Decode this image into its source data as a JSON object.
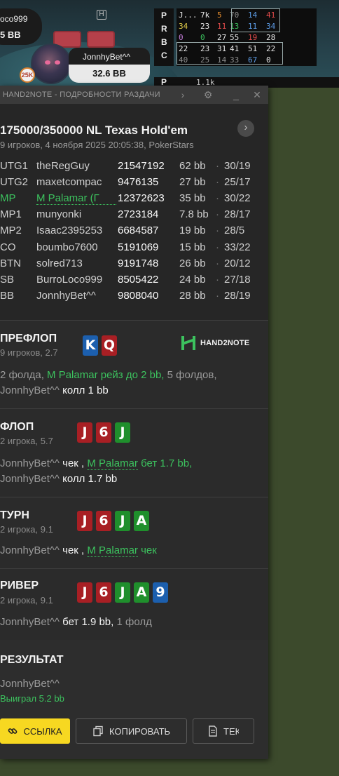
{
  "table": {
    "left_seat_name": "oco999",
    "left_seat_stack": "5 BB",
    "dealer_marker": "H",
    "hero_name": "JonnhyBet^^",
    "hero_stack": "32.6 BB",
    "badge": "25K"
  },
  "hud": {
    "letters": [
      "P",
      "R",
      "B",
      "C"
    ],
    "rows": [
      [
        {
          "v": "J...",
          "c": "#e6e6e6"
        },
        {
          "v": "7k",
          "c": "#e6e6e6"
        },
        {
          "v": "5",
          "c": "#e08a2e"
        },
        {
          "v": "70",
          "c": "#8c8c8c"
        },
        {
          "v": "14",
          "c": "#5c9ce6"
        },
        {
          "v": "41",
          "c": "#e04a4a"
        }
      ],
      [
        {
          "v": "34",
          "c": "#e6d04a"
        },
        {
          "v": "23",
          "c": "#e6e6e6"
        },
        {
          "v": "11",
          "c": "#e04a4a"
        },
        {
          "v": "13",
          "c": "#3cc25e"
        },
        {
          "v": "11",
          "c": "#5c9ce6"
        },
        {
          "v": "34",
          "c": "#5c9ce6"
        }
      ],
      [
        {
          "v": "0",
          "c": "#c07ad6"
        },
        {
          "v": "0",
          "c": "#3cc25e"
        },
        {
          "v": "27",
          "c": "#e6e6e6"
        },
        {
          "v": "55",
          "c": "#e6e6e6"
        },
        {
          "v": "19",
          "c": "#e04a4a"
        },
        {
          "v": "28",
          "c": "#e6e6e6"
        }
      ],
      [
        {
          "v": "22",
          "c": "#e6e6e6"
        },
        {
          "v": "23",
          "c": "#e6e6e6"
        },
        {
          "v": "31",
          "c": "#e6e6e6"
        },
        {
          "v": "41",
          "c": "#e6e6e6"
        },
        {
          "v": "51",
          "c": "#e6e6e6"
        },
        {
          "v": "22",
          "c": "#e6e6e6"
        }
      ],
      [
        {
          "v": "40",
          "c": "#8c8c8c"
        },
        {
          "v": "25",
          "c": "#8c8c8c"
        },
        {
          "v": "14",
          "c": "#8c8c8c"
        },
        {
          "v": "33",
          "c": "#8c8c8c"
        },
        {
          "v": "67",
          "c": "#5c9ce6"
        },
        {
          "v": "0",
          "c": "#e6e6e6"
        }
      ]
    ],
    "bottom_letter": "P",
    "bottom_text": "1.1k"
  },
  "window": {
    "title": "HAND2NOTE - ПОДРОБНОСТИ РАЗДАЧИ",
    "game_title": "175000/350000 NL Texas Hold'em",
    "game_sub": "9 игроков, 4 ноября 2025 20:05:38, PokerStars",
    "next_icon": "›",
    "players": [
      {
        "pos": "UTG1",
        "name": "theRegGuy",
        "id": "21547192",
        "bb": "62 bb",
        "stat": "30/19",
        "hl": false
      },
      {
        "pos": "UTG2",
        "name": "maxetcompac",
        "id": "9476135",
        "bb": "27 bb",
        "stat": "25/17",
        "hl": false
      },
      {
        "pos": "MP",
        "name": "M Palamar (Г",
        "id": "12372623",
        "bb": "35 bb",
        "stat": "30/22",
        "hl": true
      },
      {
        "pos": "MP1",
        "name": "munyonki",
        "id": "2723184",
        "bb": "7.8 bb",
        "stat": "28/17",
        "hl": false
      },
      {
        "pos": "MP2",
        "name": "Isaac2395253",
        "id": "6684587",
        "bb": "19 bb",
        "stat": "28/5",
        "hl": false
      },
      {
        "pos": "CO",
        "name": "boumbo7600",
        "id": "5191069",
        "bb": "15 bb",
        "stat": "33/22",
        "hl": false
      },
      {
        "pos": "BTN",
        "name": "solred713",
        "id": "9191748",
        "bb": "26 bb",
        "stat": "20/12",
        "hl": false
      },
      {
        "pos": "SB",
        "name": "BurroLoco999",
        "id": "8505422",
        "bb": "24 bb",
        "stat": "27/18",
        "hl": false
      },
      {
        "pos": "BB",
        "name": "JonnhyBet^^",
        "id": "9808040",
        "bb": "28 bb",
        "stat": "28/19",
        "hl": false
      }
    ],
    "dot": "·"
  },
  "preflop": {
    "title": "ПРЕФЛОП",
    "sub": "9 игроков, 2.7",
    "logo": "HAND2NOTE",
    "cards": [
      {
        "r": "K",
        "s": "s"
      },
      {
        "r": "Q",
        "s": "h"
      }
    ],
    "line1": {
      "a": "2 фолда, ",
      "b": "M Palamar рейз до 2 bb,",
      "c": " 5 фолдов,"
    },
    "line2": {
      "a": "JonnhyBet^^ ",
      "b": "колл 1 bb"
    }
  },
  "flop": {
    "title": "ФЛОП",
    "sub": "2 игрока, 5.7",
    "cards": [
      {
        "r": "J",
        "s": "h"
      },
      {
        "r": "6",
        "s": "h"
      },
      {
        "r": "J",
        "s": "c"
      }
    ],
    "line1": {
      "a": "JonnhyBet^^ ",
      "b": "чек",
      "c": " , ",
      "d": "M Palamar",
      "e": " бет 1.7 bb,"
    },
    "line2": {
      "a": "JonnhyBet^^ ",
      "b": "колл 1.7 bb"
    }
  },
  "turn": {
    "title": "ТУРН",
    "sub": "2 игрока, 9.1",
    "cards": [
      {
        "r": "J",
        "s": "h"
      },
      {
        "r": "6",
        "s": "h"
      },
      {
        "r": "J",
        "s": "c"
      },
      {
        "r": "A",
        "s": "c"
      }
    ],
    "line1": {
      "a": "JonnhyBet^^ ",
      "b": "чек",
      "c": " , ",
      "d": "M Palamar",
      "e": " чек"
    }
  },
  "river": {
    "title": "РИВЕР",
    "sub": "2 игрока, 9.1",
    "cards": [
      {
        "r": "J",
        "s": "h"
      },
      {
        "r": "6",
        "s": "h"
      },
      {
        "r": "J",
        "s": "c"
      },
      {
        "r": "A",
        "s": "c"
      },
      {
        "r": "9",
        "s": "s"
      }
    ],
    "line1": {
      "a": "JonnhyBet^^ ",
      "b": "бет 1.9 bb,",
      "c": " 1 фолд"
    }
  },
  "result": {
    "title": "РЕЗУЛЬТАТ",
    "winner": "JonnhyBet^^",
    "won": "Выиграл 5.2 bb",
    "btn_link": "ССЫЛКА",
    "btn_copy": "КОПИРОВАТЬ",
    "btn_text": "ТЕКСТ"
  },
  "colors": {
    "accent_green": "#3cc25e",
    "link_yellow": "#f7d821",
    "hearts": "#a81f24",
    "clubs": "#1f8f2c",
    "spades": "#1c5fae"
  }
}
